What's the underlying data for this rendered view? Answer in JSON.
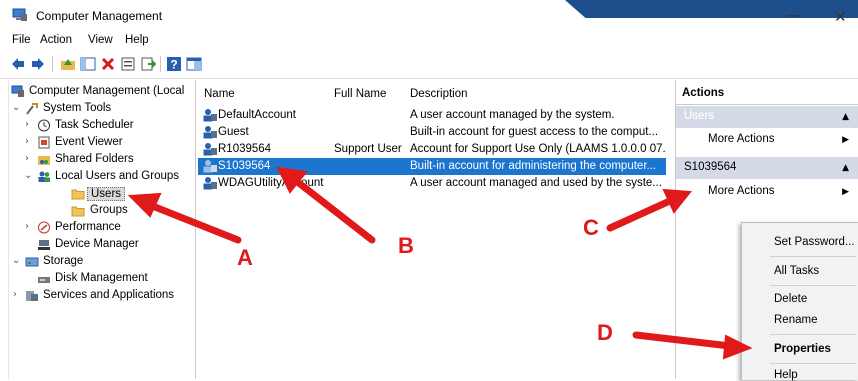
{
  "window": {
    "title": "Computer Management",
    "minimize_glyph": "—",
    "close_glyph": "✕"
  },
  "menu": [
    "File",
    "Action",
    "View",
    "Help"
  ],
  "toolbar_icons": [
    "back-icon",
    "forward-icon",
    "up-folder-icon",
    "show-hide-tree-icon",
    "delete-icon",
    "properties-icon",
    "export-icon",
    "help-icon",
    "mmc-icon"
  ],
  "tree": {
    "root": "Computer Management (Local",
    "system_tools": "System Tools",
    "task_scheduler": "Task Scheduler",
    "event_viewer": "Event Viewer",
    "shared_folders": "Shared Folders",
    "local_users_groups": "Local Users and Groups",
    "users": "Users",
    "groups": "Groups",
    "performance": "Performance",
    "device_manager": "Device Manager",
    "storage": "Storage",
    "disk_management": "Disk Management",
    "services_apps": "Services and Applications"
  },
  "list": {
    "headers": {
      "name": "Name",
      "full_name": "Full Name",
      "description": "Description"
    },
    "rows": [
      {
        "name": "DefaultAccount",
        "full_name": "",
        "description": "A user account managed by the system."
      },
      {
        "name": "Guest",
        "full_name": "",
        "description": "Built-in account for guest access to the comput..."
      },
      {
        "name": "R1039564",
        "full_name": "Support User",
        "description": "Account for Support Use Only (LAAMS 1.0.0.0 07..."
      },
      {
        "name": "S1039564",
        "full_name": "",
        "description": "Built-in account for administering the computer..."
      },
      {
        "name": "WDAGUtilityAccount",
        "full_name": "",
        "description": "A user account managed and used by the syste..."
      }
    ],
    "selected_index": 3
  },
  "actions": {
    "header": "Actions",
    "section1": "Users",
    "more1": "More Actions",
    "section2": "S1039564",
    "more2": "More Actions"
  },
  "context_menu": {
    "set_password": "Set Password...",
    "all_tasks": "All Tasks",
    "delete": "Delete",
    "rename": "Rename",
    "properties": "Properties",
    "help": "Help"
  },
  "annotations": {
    "a": "A",
    "b": "B",
    "c": "C",
    "d": "D"
  },
  "colors": {
    "selection": "#1c75cf",
    "annotation": "#e0191a",
    "action_section": "#d4dbe6",
    "title_ribbon": "#1f4e8c"
  }
}
